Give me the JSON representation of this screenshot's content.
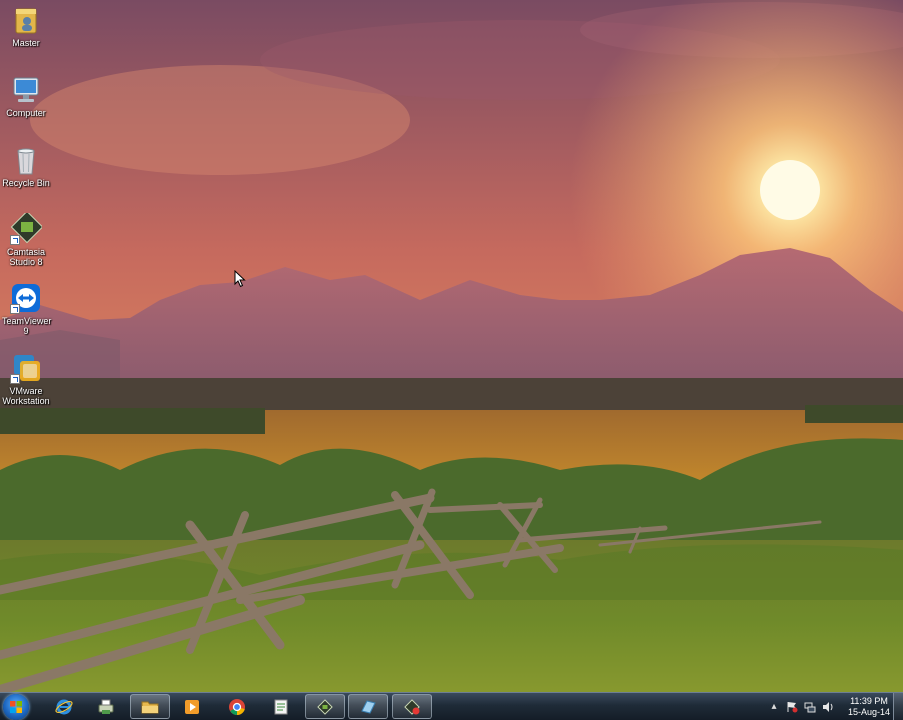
{
  "desktop": {
    "icons": [
      {
        "label": "Master",
        "icon": "folder-user-icon"
      },
      {
        "label": "Computer",
        "icon": "computer-icon"
      },
      {
        "label": "Recycle Bin",
        "icon": "recycle-bin-icon"
      },
      {
        "label": "Camtasia Studio 8",
        "icon": "camtasia-icon"
      },
      {
        "label": "TeamViewer 9",
        "icon": "teamviewer-icon"
      },
      {
        "label": "VMware Workstation",
        "icon": "vmware-icon"
      }
    ]
  },
  "taskbar": {
    "buttons": [
      {
        "name": "internet-explorer",
        "icon": "internet-explorer-icon",
        "open": false
      },
      {
        "name": "printer-app",
        "icon": "printer-icon",
        "open": false
      },
      {
        "name": "windows-explorer",
        "icon": "folder-icon",
        "open": true
      },
      {
        "name": "media-player",
        "icon": "media-player-icon",
        "open": false
      },
      {
        "name": "chrome",
        "icon": "chrome-icon",
        "open": false
      },
      {
        "name": "notepad-app",
        "icon": "notepad-icon",
        "open": false
      },
      {
        "name": "camtasia-studio",
        "icon": "camtasia-icon",
        "open": true
      },
      {
        "name": "app-window",
        "icon": "app-window-icon",
        "open": true
      },
      {
        "name": "camtasia-recorder",
        "icon": "camtasia-recorder-icon",
        "open": true
      }
    ],
    "tray": {
      "overflow_glyph": "▴",
      "clock_time": "11:39 PM",
      "clock_date": "15-Aug-14"
    }
  },
  "colors": {
    "taskbar": "#1f2b38",
    "sky_top": "#7e4a5e",
    "sun": "#fff6c8"
  }
}
